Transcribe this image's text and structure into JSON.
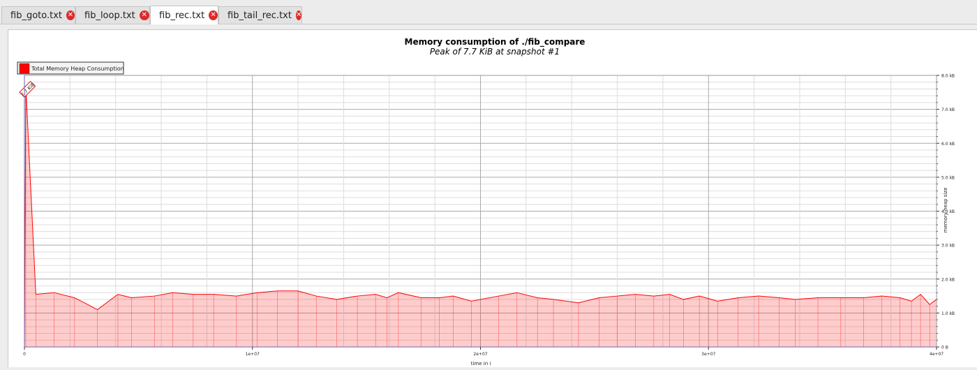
{
  "tabs": [
    {
      "label": "fib_goto.txt",
      "active": false
    },
    {
      "label": "fib_loop.txt",
      "active": false
    },
    {
      "label": "fib_rec.txt",
      "active": true
    },
    {
      "label": "fib_tail_rec.txt",
      "active": false
    }
  ],
  "chart_data": {
    "type": "area",
    "title": "Memory consumption of ./fib_compare",
    "subtitle": "Peak of 7.7 KiB at snapshot #1",
    "legend": {
      "label": "Total Memory Heap Consumption",
      "placement": "top-left"
    },
    "peak_label": "7.7 KiB",
    "xlabel": "time in i",
    "ylabel": "memory heap size",
    "xlim": [
      0,
      40000000
    ],
    "ylim": [
      0,
      8000
    ],
    "x_ticks": [
      {
        "v": 0,
        "label": "0"
      },
      {
        "v": 10000000,
        "label": "1e+07"
      },
      {
        "v": 20000000,
        "label": "2e+07"
      },
      {
        "v": 30000000,
        "label": "3e+07"
      },
      {
        "v": 40000000,
        "label": "4e+07"
      }
    ],
    "y_ticks": [
      {
        "v": 0,
        "label": "0 B"
      },
      {
        "v": 1000,
        "label": "1.0 kB"
      },
      {
        "v": 2000,
        "label": "2.0 kB"
      },
      {
        "v": 3000,
        "label": "3.0 kB"
      },
      {
        "v": 4000,
        "label": "4.0 kB"
      },
      {
        "v": 5000,
        "label": "5.0 kB"
      },
      {
        "v": 6000,
        "label": "6.0 kB"
      },
      {
        "v": 7000,
        "label": "7.0 kB"
      },
      {
        "v": 8000,
        "label": "8.0 kB"
      }
    ],
    "series": [
      {
        "color": "#ff0000",
        "x": [
          0,
          60000,
          500000,
          1300000,
          2200000,
          3200000,
          4100000,
          4700000,
          5700000,
          6500000,
          7400000,
          8300000,
          9300000,
          10200000,
          11100000,
          12000000,
          12800000,
          13700000,
          14600000,
          15400000,
          15900000,
          16400000,
          17400000,
          18200000,
          18800000,
          19600000,
          20800000,
          21600000,
          22500000,
          23200000,
          24300000,
          25200000,
          26000000,
          26800000,
          27600000,
          28300000,
          28900000,
          29600000,
          30400000,
          31300000,
          32200000,
          33100000,
          33800000,
          34800000,
          35800000,
          36800000,
          37600000,
          38400000,
          38900000,
          39300000,
          39700000,
          40000000
        ],
        "y": [
          0,
          7700,
          1550,
          1600,
          1450,
          1100,
          1550,
          1450,
          1500,
          1600,
          1550,
          1550,
          1500,
          1600,
          1650,
          1650,
          1500,
          1400,
          1500,
          1550,
          1450,
          1600,
          1450,
          1450,
          1500,
          1350,
          1500,
          1600,
          1450,
          1400,
          1300,
          1450,
          1500,
          1550,
          1500,
          1550,
          1400,
          1500,
          1350,
          1450,
          1500,
          1450,
          1400,
          1450,
          1450,
          1450,
          1500,
          1450,
          1350,
          1550,
          1250,
          1400
        ]
      }
    ]
  }
}
